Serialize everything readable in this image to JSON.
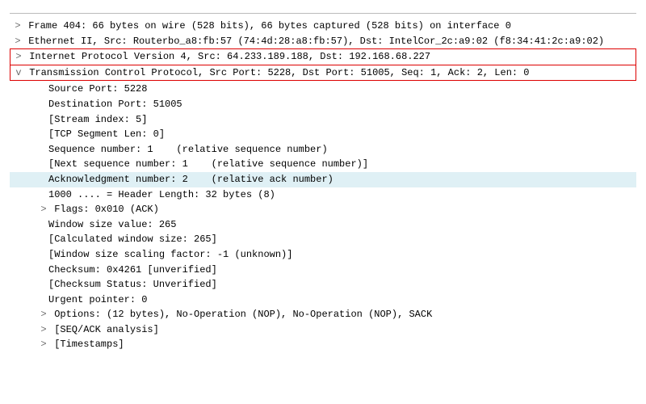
{
  "top": {
    "frame": " Frame 404: 66 bytes on wire (528 bits), 66 bytes captured (528 bits) on interface 0",
    "ethernet": " Ethernet II, Src: Routerbo_a8:fb:57 (74:4d:28:a8:fb:57), Dst: IntelCor_2c:a9:02 (f8:34:41:2c:a9:02)",
    "ip": " Internet Protocol Version 4, Src: 64.233.189.188, Dst: 192.168.68.227",
    "tcp": " Transmission Control Protocol, Src Port: 5228, Dst Port: 51005, Seq: 1, Ack: 2, Len: 0"
  },
  "tcp": {
    "src_port": "Source Port: 5228",
    "dst_port": "Destination Port: 51005",
    "stream_index": "[Stream index: 5]",
    "seg_len": "[TCP Segment Len: 0]",
    "seq_label": "Sequence number: 1",
    "seq_note": "    (relative sequence number)",
    "next_seq_label": "[Next sequence number: 1",
    "next_seq_note": "    (relative sequence number)]",
    "ack_label": "Acknowledgment number: 2",
    "ack_note": "    (relative ack number)",
    "header_len": "1000 .... = Header Length: 32 bytes (8)",
    "flags": " Flags: 0x010 (ACK)",
    "win_size": "Window size value: 265",
    "calc_win": "[Calculated window size: 265]",
    "win_scale": "[Window size scaling factor: -1 (unknown)]",
    "checksum": "Checksum: 0x4261 [unverified]",
    "checksum_status": "[Checksum Status: Unverified]",
    "urgent_ptr": "Urgent pointer: 0",
    "options": " Options: (12 bytes), No-Operation (NOP), No-Operation (NOP), SACK",
    "seqack": " [SEQ/ACK analysis]",
    "timestamps": " [Timestamps]"
  }
}
